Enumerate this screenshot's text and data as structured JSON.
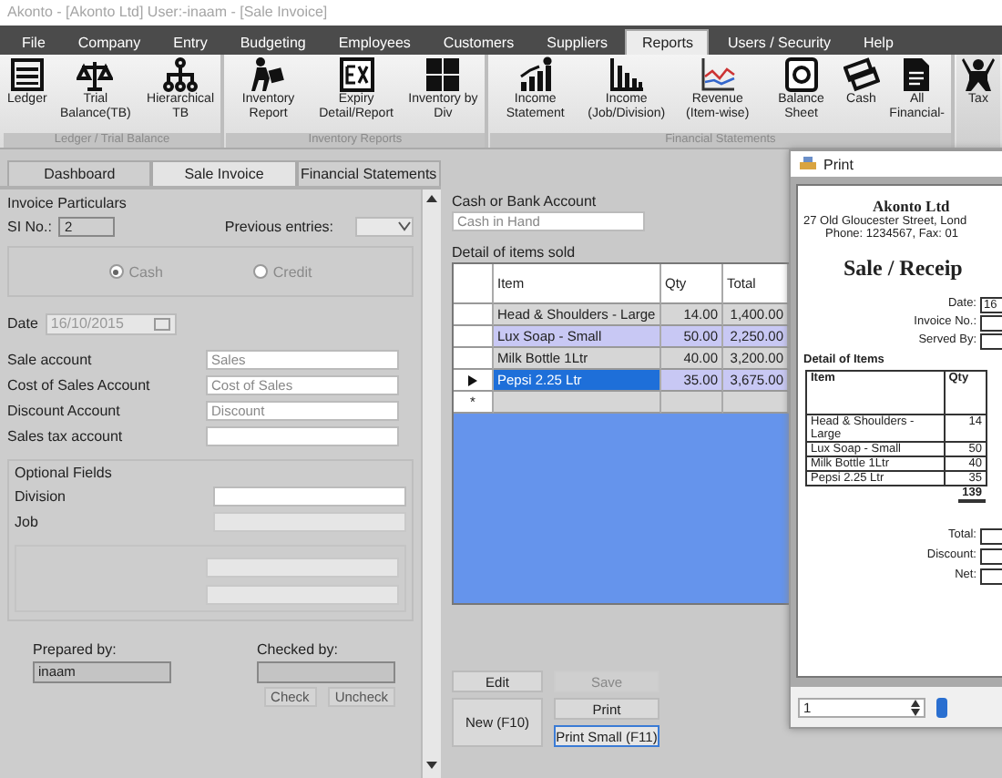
{
  "window": {
    "title": "Akonto - [Akonto Ltd]  User:-inaam - [Sale Invoice]"
  },
  "menu": [
    {
      "label": "File",
      "selected": false
    },
    {
      "label": "Company",
      "selected": false
    },
    {
      "label": "Entry",
      "selected": false
    },
    {
      "label": "Budgeting",
      "selected": false
    },
    {
      "label": "Employees",
      "selected": false
    },
    {
      "label": "Customers",
      "selected": false
    },
    {
      "label": "Suppliers",
      "selected": false
    },
    {
      "label": "Reports",
      "selected": true
    },
    {
      "label": "Users / Security",
      "selected": false
    },
    {
      "label": "Help",
      "selected": false
    }
  ],
  "ribbon": {
    "groups": [
      {
        "caption": "Ledger / Trial Balance",
        "items": [
          {
            "label": "Ledger",
            "kind": "abacus"
          },
          {
            "label": "Trial Balance(TB)",
            "kind": "scales"
          },
          {
            "label": "Hierarchical TB",
            "kind": "hierarchy"
          }
        ]
      },
      {
        "caption": "Inventory Reports",
        "items": [
          {
            "label": "Inventory Report",
            "kind": "worker"
          },
          {
            "label": "Expiry Detail/Report",
            "kind": "ex"
          },
          {
            "label": "Inventory by Div",
            "kind": "tiles"
          }
        ]
      },
      {
        "caption": "Financial Statements",
        "items": [
          {
            "label": "Income Statement",
            "kind": "growth"
          },
          {
            "label": "Income (Job/Division)",
            "kind": "bars"
          },
          {
            "label": "Revenue (Item-wise)",
            "kind": "line"
          },
          {
            "label": "Balance Sheet",
            "kind": "sheet"
          },
          {
            "label": "Cash",
            "kind": "cash"
          },
          {
            "label": "All Financial-",
            "kind": "document"
          }
        ]
      },
      {
        "items": [
          {
            "label": "Tax",
            "kind": "figure"
          }
        ]
      }
    ]
  },
  "tabs": [
    {
      "label": "Dashboard",
      "selected": false
    },
    {
      "label": "Sale Invoice",
      "selected": true
    },
    {
      "label": "Financial Statements",
      "selected": false
    }
  ],
  "invoice_form": {
    "title": "Invoice Particulars",
    "si_no": {
      "label": "SI No.:",
      "value": "2"
    },
    "previous_entries": {
      "label": "Previous entries:"
    },
    "invoice_type": [
      {
        "label": "Cash",
        "selected": true
      },
      {
        "label": "Credit",
        "selected": false
      }
    ],
    "date": {
      "label": "Date",
      "value": "16/10/2015",
      "disabled": true
    },
    "accounts": [
      {
        "label": "Sale account",
        "placeholder": "Sales"
      },
      {
        "label": "Cost of Sales Account",
        "placeholder": "Cost of Sales"
      },
      {
        "label": "Discount Account",
        "placeholder": "Discount"
      },
      {
        "label": "Sales tax account"
      }
    ],
    "optional_fields": {
      "title": "Optional Fields",
      "fields": [
        {
          "label": "Division",
          "disabled": false
        },
        {
          "label": "Job",
          "disabled": true
        }
      ],
      "customer_fields": [
        {
          "disabled": true
        },
        {
          "disabled": true
        }
      ]
    },
    "prepared_by": {
      "label": "Prepared by:",
      "value": "inaam"
    },
    "checked_by": {
      "label": "Checked by:"
    },
    "check_buttons": [
      "Check",
      "Uncheck"
    ]
  },
  "cash_account": {
    "label": "Cash or Bank Account",
    "placeholder": "Cash in Hand"
  },
  "items_grid": {
    "title": "Detail of items sold",
    "columns": [
      "Item",
      "Qty",
      "Total"
    ],
    "rows": [
      {
        "cells": [
          "Head & Shoulders - Large",
          "14.00",
          "1,400.00"
        ],
        "selected": false
      },
      {
        "cells": [
          "Lux Soap - Small",
          "50.00",
          "2,250.00"
        ],
        "selected": false
      },
      {
        "cells": [
          "Milk Bottle 1Ltr",
          "40.00",
          "3,200.00"
        ],
        "selected": false
      },
      {
        "cells": [
          "Pepsi 2.25 Ltr",
          "35.00",
          "3,675.00"
        ],
        "selected": true
      }
    ],
    "new_row_marker": "*"
  },
  "actions": [
    {
      "label": "Edit",
      "disabled": false,
      "focused": false
    },
    {
      "label": "Save",
      "disabled": true,
      "focused": false
    },
    {
      "label": "Print",
      "disabled": false,
      "focused": false
    },
    {
      "label": "New (F10)",
      "disabled": false,
      "focused": false
    },
    {
      "label": "Print Small (F11)",
      "disabled": false,
      "focused": true
    }
  ],
  "print_dialog": {
    "title": "Print",
    "company": "Akonto Ltd",
    "address": "27 Old Gloucester Street, Lond",
    "phone": "Phone: 1234567, Fax: 01",
    "heading": "Sale / Receip",
    "info": [
      {
        "label": "Date:",
        "value": "16"
      },
      {
        "label": "Invoice No.:"
      },
      {
        "label": "Served By:"
      }
    ],
    "items_title": "Detail of Items",
    "columns": [
      "Item",
      "Qty"
    ],
    "rows": [
      [
        "Head & Shoulders - Large",
        "14"
      ],
      [
        "Lux Soap - Small",
        "50"
      ],
      [
        "Milk Bottle 1Ltr",
        "40"
      ],
      [
        "Pepsi 2.25 Ltr",
        "35"
      ]
    ],
    "qty_total": "139",
    "totals": [
      "Total:",
      "Discount:",
      "Net:"
    ],
    "page": "1"
  }
}
